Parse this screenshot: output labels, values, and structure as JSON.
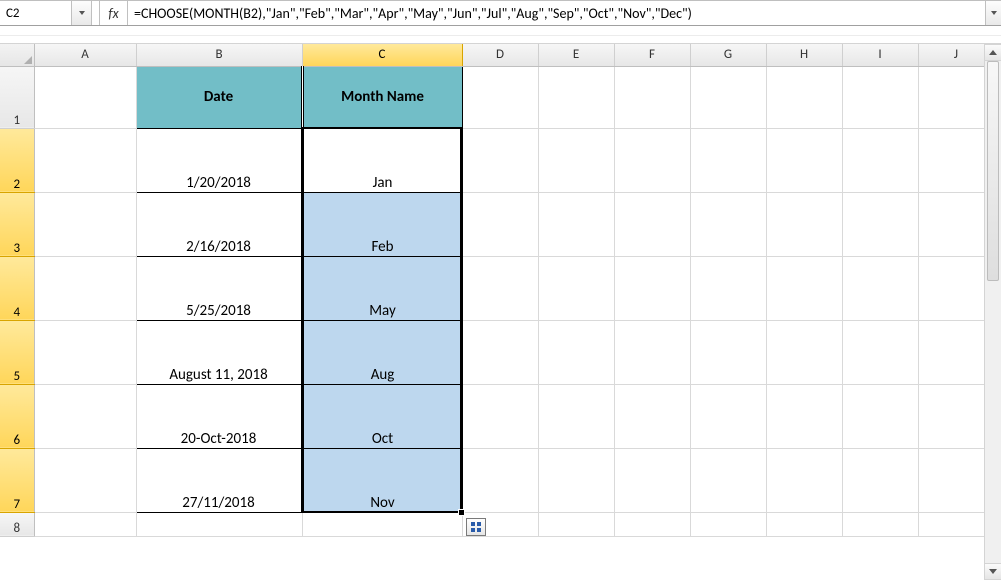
{
  "name_box": "C2",
  "formula": "=CHOOSE(MONTH(B2),\"Jan\",\"Feb\",\"Mar\",\"Apr\",\"May\",\"Jun\",\"Jul\",\"Aug\",\"Sep\",\"Oct\",\"Nov\",\"Dec\")",
  "fx_label": "fx",
  "columns": [
    "A",
    "B",
    "C",
    "D",
    "E",
    "F",
    "G",
    "H",
    "I",
    "J"
  ],
  "active_col": "C",
  "rows_visible": [
    1,
    2,
    3,
    4,
    5,
    6,
    7,
    8
  ],
  "selected_rows": [
    2,
    3,
    4,
    5,
    6,
    7
  ],
  "headers": {
    "date": "Date",
    "month": "Month Name"
  },
  "data": [
    {
      "date": "1/20/2018",
      "month": "Jan"
    },
    {
      "date": "2/16/2018",
      "month": "Feb"
    },
    {
      "date": "5/25/2018",
      "month": "May"
    },
    {
      "date": "August 11, 2018",
      "month": "Aug"
    },
    {
      "date": "20-Oct-2018",
      "month": "Oct"
    },
    {
      "date": "27/11/2018",
      "month": "Nov"
    }
  ],
  "colors": {
    "header_fill": "#72bec7",
    "sel_fill": "#bdd7ee"
  }
}
